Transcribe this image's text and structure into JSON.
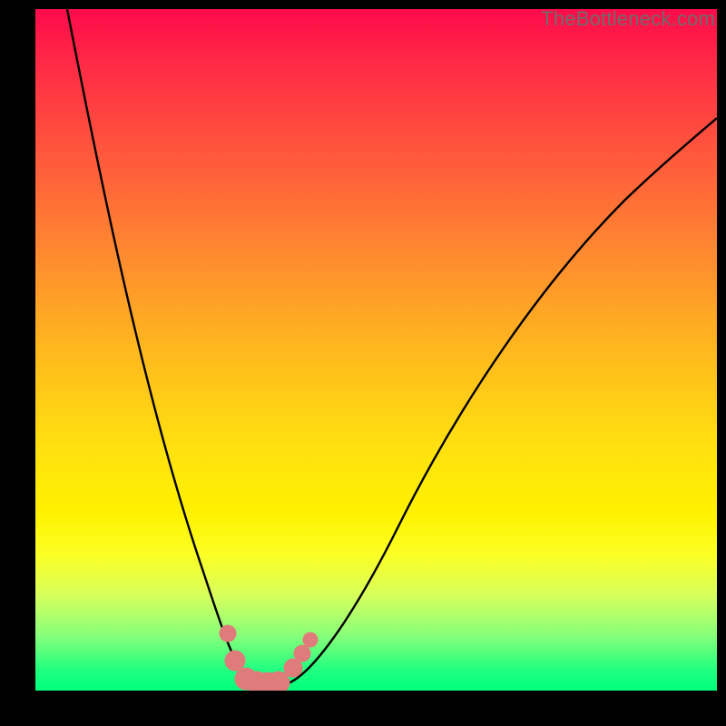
{
  "watermark": "TheBottleneck.com",
  "colors": {
    "background_frame": "#000000",
    "gradient_top": "#ff0a4a",
    "gradient_bottom": "#00ff7c",
    "curve": "#000000",
    "markers": "#e07b7b"
  },
  "chart_data": {
    "type": "line",
    "title": "",
    "xlabel": "",
    "ylabel": "",
    "xlim": [
      0,
      100
    ],
    "ylim": [
      0,
      100
    ],
    "x_optimum": 33,
    "description": "V-shaped bottleneck curve with minimum near x≈33; background hue encodes bottleneck severity (red=high, green=low). Salmon circular markers cluster at the valley floor.",
    "series": [
      {
        "name": "bottleneck-curve",
        "x": [
          5,
          10,
          15,
          20,
          25,
          28,
          30,
          32,
          33,
          34,
          36,
          38,
          40,
          45,
          50,
          55,
          60,
          65,
          70,
          75,
          80,
          85,
          90,
          95,
          99
        ],
        "values": [
          100,
          80,
          60,
          40,
          20,
          10,
          5,
          2,
          1,
          1,
          2,
          4,
          6,
          12,
          18,
          25,
          32,
          39,
          46,
          52,
          58,
          64,
          69,
          72,
          74
        ]
      }
    ],
    "markers": [
      {
        "x": 28.5,
        "y": 8.5
      },
      {
        "x": 29.5,
        "y": 3.5
      },
      {
        "x": 30.5,
        "y": 1.8
      },
      {
        "x": 32.0,
        "y": 1.2
      },
      {
        "x": 33.5,
        "y": 1.2
      },
      {
        "x": 35.0,
        "y": 1.2
      },
      {
        "x": 36.5,
        "y": 2.0
      },
      {
        "x": 38.0,
        "y": 3.8
      },
      {
        "x": 39.0,
        "y": 6.5
      },
      {
        "x": 40.0,
        "y": 9.0
      }
    ]
  }
}
